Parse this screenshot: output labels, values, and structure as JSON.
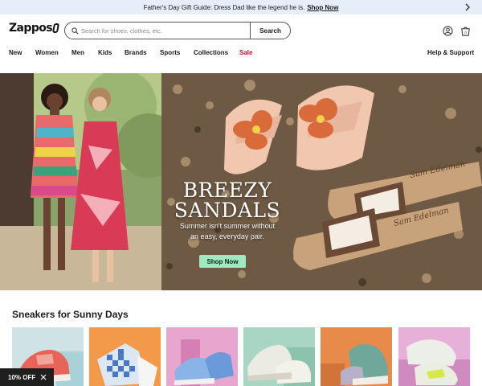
{
  "promo": {
    "text": "Father's Day Gift Guide: Dress Dad like the legend he is.",
    "link": "Shop Now"
  },
  "header": {
    "logo": "Zappos",
    "search_placeholder": "Search for shoes, clothes, etc.",
    "search_button": "Search"
  },
  "nav": {
    "items": [
      "New",
      "Women",
      "Men",
      "Kids",
      "Brands",
      "Sports",
      "Collections",
      "Sale"
    ],
    "help": "Help & Support"
  },
  "hero": {
    "title_line1": "BREEZY",
    "title_line2": "SANDALS",
    "subtitle_line1": "Summer isn't summer without",
    "subtitle_line2": "an easy, everyday pair.",
    "button": "Shop Now"
  },
  "section": {
    "title": "Sneakers for Sunny Days"
  },
  "toast": {
    "text": "10% OFF"
  },
  "colors": {
    "promo_bg": "#e6eef9",
    "sale": "#c8102e",
    "hero_button": "#9fe8c0"
  }
}
